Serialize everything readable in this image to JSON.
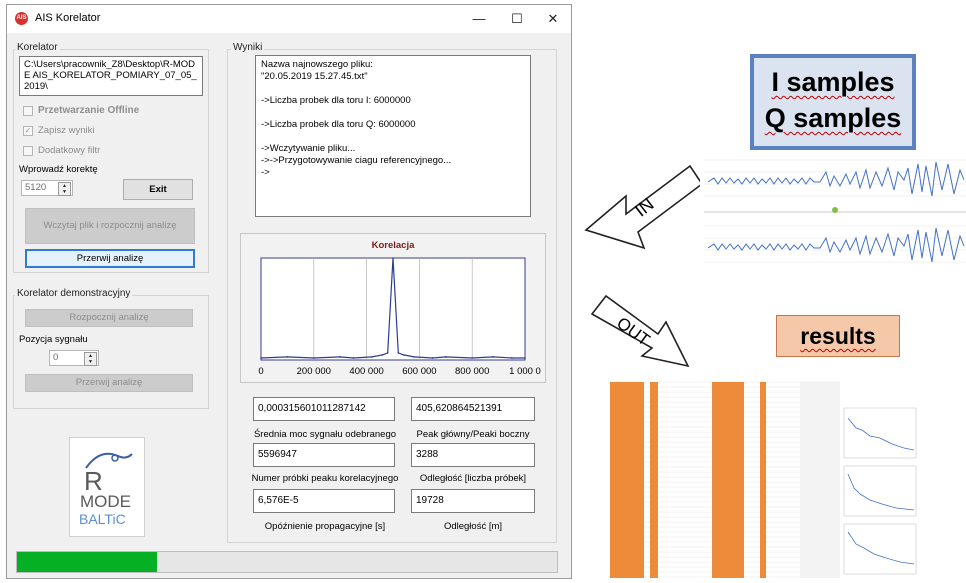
{
  "window": {
    "title": "AIS Korelator",
    "minimize_glyph": "—",
    "maximize_glyph": "☐",
    "close_glyph": "✕",
    "app_icon": "ais-app-icon"
  },
  "korelator": {
    "group_label": "Korelator",
    "path": "C:\\Users\\pracownik_Z8\\Desktop\\R-MODE AIS_KORELATOR_POMIARY_07_05_2019\\",
    "offline_label": "Przetwarzanie Offline",
    "offline_checked": false,
    "save_label": "Zapisz wyniki",
    "save_checked": true,
    "filter_label": "Dodatkowy filtr",
    "filter_checked": false,
    "correction_label": "Wprowadź korektę",
    "correction_value": "5120",
    "exit_label": "Exit",
    "load_start_label": "Wczytaj plik i rozpocznij analizę",
    "stop_label": "Przerwij analizę"
  },
  "demo": {
    "group_label": "Korelator demonstracyjny",
    "start_label": "Rozpocznij analizę",
    "position_label": "Pozycja sygnału",
    "position_value": "0",
    "stop_label": "Przerwij analizę"
  },
  "logo": {
    "line1": "R",
    "line2": "MODE",
    "line3": "BALTiC"
  },
  "wyniki": {
    "group_label": "Wyniki",
    "log": "Nazwa najnowszego pliku:\n\"20.05.2019 15.27.45.txt\"\n\n->Liczba probek dla toru I: 6000000\n\n->Liczba probek dla toru Q: 6000000\n\n->Wczytywanie pliku...\n->->Przygotowywanie ciagu referencyjnego...\n->"
  },
  "chart_data": {
    "type": "line",
    "title": "Korelacja",
    "x_tick_labels": [
      "0",
      "200 000",
      "400 000",
      "600 000",
      "800 000",
      "1 000 0"
    ],
    "xlim": [
      0,
      1000000
    ],
    "ylim": [
      0,
      1
    ],
    "grid": true,
    "color": "#2c3c93",
    "title_color": "#7a1a1a",
    "x": [
      0,
      100000,
      200000,
      300000,
      350000,
      420000,
      460000,
      480000,
      500000,
      520000,
      540000,
      580000,
      650000,
      700000,
      800000,
      880000,
      950000,
      1000000
    ],
    "y": [
      0.02,
      0.03,
      0.02,
      0.03,
      0.02,
      0.03,
      0.05,
      0.07,
      1.0,
      0.07,
      0.05,
      0.03,
      0.02,
      0.03,
      0.02,
      0.03,
      0.02,
      0.02
    ]
  },
  "metrics": [
    {
      "value": "0,000315601011287142",
      "caption": "Średnia moc sygnału odebranego"
    },
    {
      "value": "405,620864521391",
      "caption": "Peak główny/Peaki boczny"
    },
    {
      "value": "5596947",
      "caption": "Numer próbki peaku korelacyjnego"
    },
    {
      "value": "3288",
      "caption": "Odległość [liczba próbek]"
    },
    {
      "value": "6,576E-5",
      "caption": "Opóźnienie propagacyjne [s]"
    },
    {
      "value": "19728",
      "caption": "Odległość [m]"
    }
  ],
  "progress": {
    "fraction": 0.26,
    "color": "#06b025"
  },
  "diagram": {
    "iq_line1": "I  samples",
    "iq_line2": "Q samples",
    "in_label": "IN",
    "out_label": "OUT",
    "results_label": "results"
  }
}
